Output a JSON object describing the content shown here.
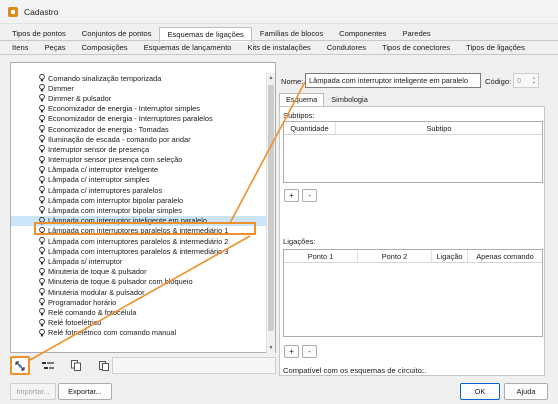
{
  "window": {
    "title": "Cadastro"
  },
  "main_tabs": [
    {
      "label": "Tipos de pontos"
    },
    {
      "label": "Conjuntos de pontos"
    },
    {
      "label": "Esquemas de ligações",
      "active": true
    },
    {
      "label": "Famílias de blocos"
    },
    {
      "label": "Componentes"
    },
    {
      "label": "Paredes"
    }
  ],
  "sub_tabs": [
    {
      "label": "Itens"
    },
    {
      "label": "Peças"
    },
    {
      "label": "Composições"
    },
    {
      "label": "Esquemas de lançamento"
    },
    {
      "label": "Kits de instalações"
    },
    {
      "label": "Condutores"
    },
    {
      "label": "Tipos de conectores"
    },
    {
      "label": "Tipos de ligações"
    }
  ],
  "list": {
    "items": [
      {
        "label": "Comando sinalização temporizada"
      },
      {
        "label": "Dimmer"
      },
      {
        "label": "Dimmer & pulsador"
      },
      {
        "label": "Economizador de energia - Interruptor simples"
      },
      {
        "label": "Economizador de energia - Interruptores paralelos"
      },
      {
        "label": "Economizador de energia - Tomadas"
      },
      {
        "label": "Iluminação de escada - comando por andar"
      },
      {
        "label": "Interruptor sensor de presença"
      },
      {
        "label": "Interruptor sensor presença com seleção"
      },
      {
        "label": "Lâmpada c/ interruptor inteligente"
      },
      {
        "label": "Lâmpada c/ interruptor simples"
      },
      {
        "label": "Lâmpada c/ interruptores paralelos"
      },
      {
        "label": "Lâmpada com interruptor bipolar paralelo"
      },
      {
        "label": "Lâmpada com interruptor bipolar simples"
      },
      {
        "label": "Lâmpada com interruptor inteligente em paralelo",
        "selected": true
      },
      {
        "label": "Lâmpada com interruptores paralelos & intermediário 1"
      },
      {
        "label": "Lâmpada com interruptores paralelos & intermediário 2"
      },
      {
        "label": "Lâmpada com interruptores paralelos & intermediário 3"
      },
      {
        "label": "Lâmpada s/ interruptor"
      },
      {
        "label": "Minuteria de toque & pulsador"
      },
      {
        "label": "Minuteria de toque & pulsador com bloqueio"
      },
      {
        "label": "Minuteria modular & pulsador"
      },
      {
        "label": "Programador horário"
      },
      {
        "label": "Relé comando & fotocélula"
      },
      {
        "label": "Relé fotoelétrico"
      },
      {
        "label": "Relé fotoelétrico com comando manual"
      }
    ]
  },
  "toolbar": {
    "import_label": "Importar...",
    "export_label": "Exportar..."
  },
  "form": {
    "name_label": "Nome:",
    "name_value": "Lâmpada com interruptor inteligente em paralelo",
    "code_label": "Código:",
    "code_value": "0"
  },
  "inner_tabs": [
    {
      "label": "Esquema",
      "active": true
    },
    {
      "label": "Simbologia"
    }
  ],
  "subtipos": {
    "label": "Subtipos:",
    "columns": [
      "Quantidade",
      "Subtipo"
    ],
    "add_label": "+",
    "remove_label": "-"
  },
  "ligacoes": {
    "label": "Ligações:",
    "columns": [
      "Ponto 1",
      "Ponto 2",
      "Ligação",
      "Apenas comando"
    ],
    "add_label": "+",
    "remove_label": "-"
  },
  "compat": {
    "label": "Compatível com os esquemas de circuito:",
    "value": "..."
  },
  "footer": {
    "ok_label": "OK",
    "help_label": "Ajuda"
  },
  "colors": {
    "highlight": "#f0902a",
    "selection": "#cce4f7"
  },
  "icons": [
    "app-icon",
    "lightbulb-icon",
    "hierarchy-icon",
    "tree-icon",
    "copy-icon",
    "paste-icon",
    "plug-icon"
  ]
}
